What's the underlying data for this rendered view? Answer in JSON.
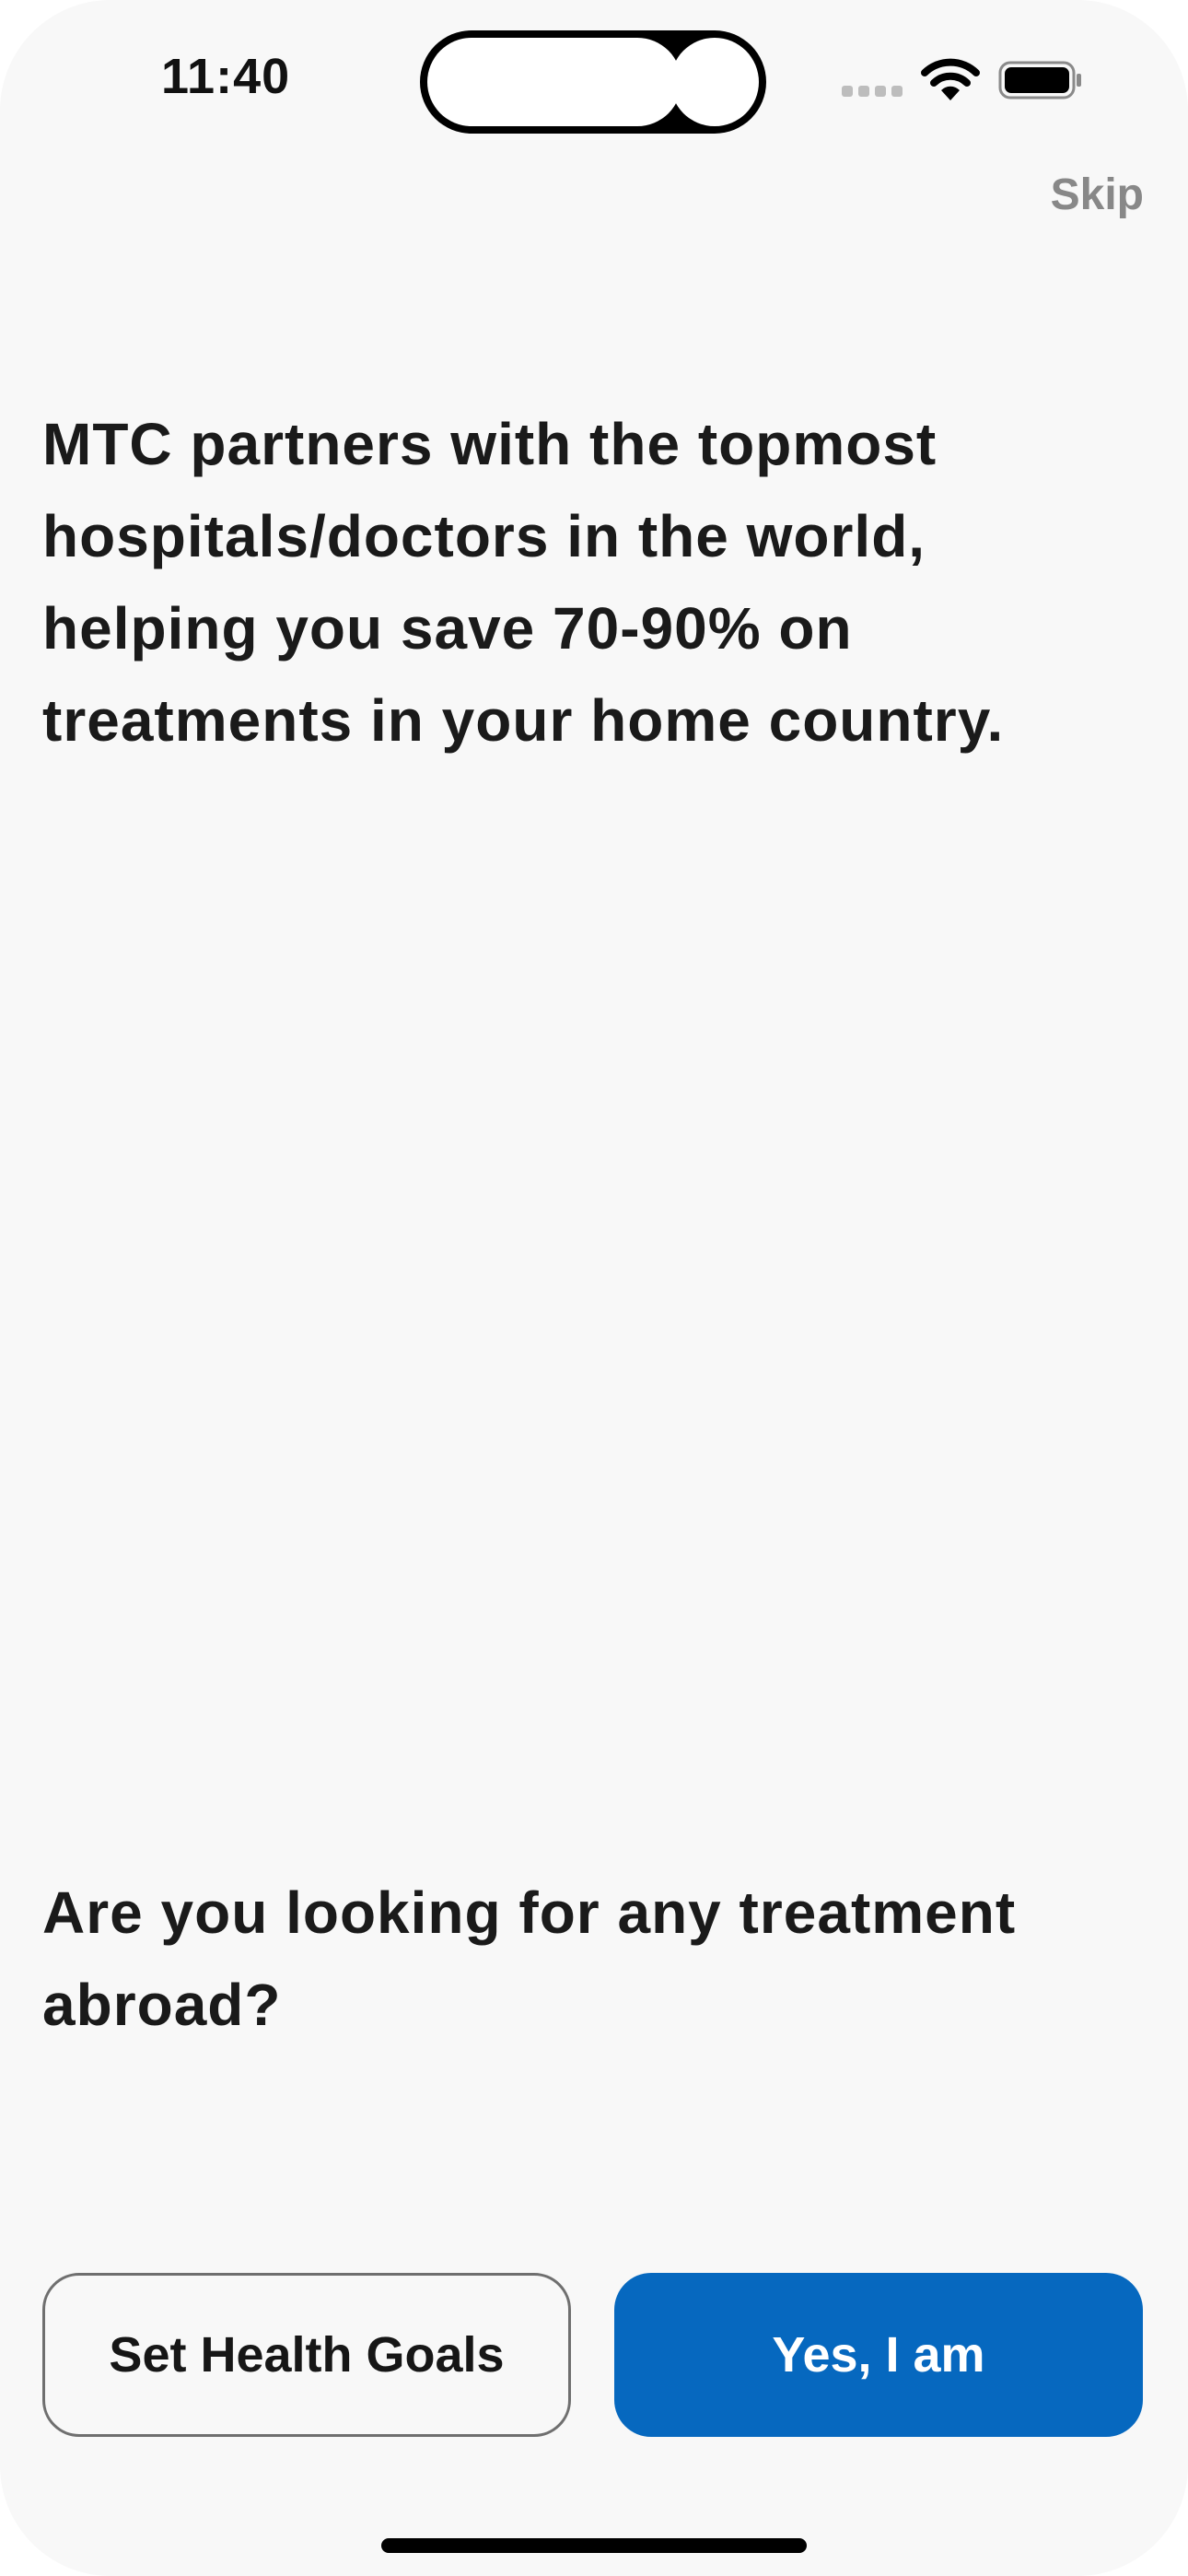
{
  "status_bar": {
    "time": "11:40",
    "icons": [
      "signal-icon",
      "wifi-icon",
      "battery-icon"
    ]
  },
  "header": {
    "skip_label": "Skip"
  },
  "main": {
    "intro": "MTC partners with the topmost hospitals/doctors in the world, helping you save 70-90% on treatments in your home country.",
    "question": "Are you looking for any treatment abroad?"
  },
  "actions": {
    "secondary_label": "Set Health Goals",
    "primary_label": "Yes, I am"
  },
  "colors": {
    "primary": "#0668bf",
    "background": "#f8f8f8",
    "text": "#1a1a1a",
    "muted": "#888888"
  }
}
